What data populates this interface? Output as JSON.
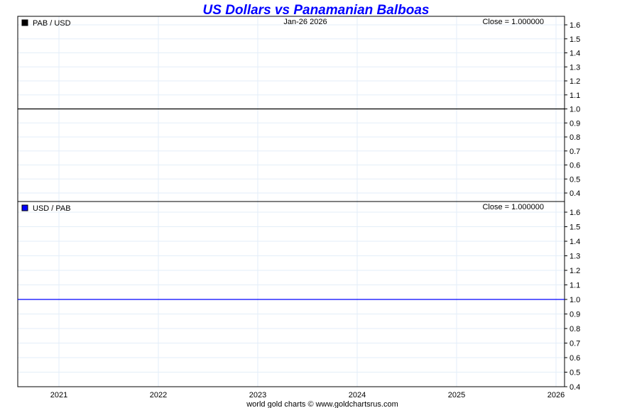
{
  "chart_data": [
    {
      "type": "line",
      "title": "US Dollars vs Panamanian Balboas",
      "legend": "PAB / USD",
      "date_label": "Jan-26  2026",
      "close_label": "Close = 1.000000",
      "series_color": "#000000",
      "x_ticks": [
        "2021",
        "2022",
        "2023",
        "2024",
        "2025",
        "2026"
      ],
      "y_ticks": [
        1.6,
        1.5,
        1.4,
        1.3,
        1.2,
        1.1,
        1.0,
        0.9,
        0.8,
        0.7,
        0.6,
        0.5,
        0.4
      ],
      "ylim": [
        0.4,
        1.6
      ],
      "values": [
        1.0,
        1.0
      ],
      "x_range": [
        "2020-08",
        "2026-01"
      ]
    },
    {
      "type": "line",
      "legend": "USD / PAB",
      "close_label": "Close = 1.000000",
      "series_color": "#0000ff",
      "x_ticks": [
        "2021",
        "2022",
        "2023",
        "2024",
        "2025",
        "2026"
      ],
      "y_ticks": [
        1.6,
        1.5,
        1.4,
        1.3,
        1.2,
        1.1,
        1.0,
        0.9,
        0.8,
        0.7,
        0.6,
        0.5,
        0.4
      ],
      "ylim": [
        0.4,
        1.6
      ],
      "values": [
        1.0,
        1.0
      ],
      "x_range": [
        "2020-08",
        "2026-01"
      ]
    }
  ],
  "footer": "world gold charts © www.goldchartsrus.com",
  "title_color": "#0000ff"
}
